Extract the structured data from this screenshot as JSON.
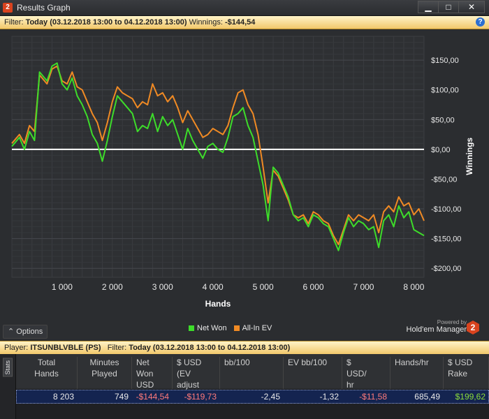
{
  "window": {
    "title": "Results Graph",
    "app_icon": "2",
    "min": "▁",
    "max": "□",
    "close": "✕"
  },
  "filter": {
    "label": "Filter:",
    "value": "Today (03.12.2018 13:00 to 04.12.2018 13:00)",
    "winnings_label": "Winnings:",
    "winnings_value": "-$144,54"
  },
  "options_label": "Options",
  "legend": {
    "net_won": "Net Won",
    "allin_ev": "All-In EV"
  },
  "powered": {
    "small": "Powered by",
    "big": "Hold'em Manager",
    "logo": "2"
  },
  "player": {
    "label": "Player:",
    "value": "ITSUNBLVBLE (PS)",
    "filter_label": "Filter:",
    "filter_value": "Today (03.12.2018 13:00 to 04.12.2018 13:00)"
  },
  "stats_tab": "Stats",
  "table": {
    "headers": [
      "Total\nHands",
      "Minutes\nPlayed",
      "Net\nWon\nUSD",
      "$ USD\n(EV\nadjust",
      "bb/100",
      "EV bb/100",
      "$\nUSD/\nhr",
      "Hands/hr",
      "$ USD\nRake"
    ],
    "row": [
      "8 203",
      "749",
      "-$144,54",
      "-$119,73",
      "-2,45",
      "-1,32",
      "-$11,58",
      "685,49",
      "$199,62"
    ]
  },
  "colors": {
    "net_won": "#3ddc2a",
    "allin_ev": "#f08a24",
    "negative": "#ff7a7a",
    "positive": "#8bdc3a"
  },
  "chart_data": {
    "type": "line",
    "xlabel": "Hands",
    "ylabel": "Winnings",
    "x_ticks": [
      "1 000",
      "2 000",
      "3 000",
      "4 000",
      "5 000",
      "6 000",
      "7 000",
      "8 000"
    ],
    "x_tick_values": [
      1000,
      2000,
      3000,
      4000,
      5000,
      6000,
      7000,
      8000
    ],
    "y_ticks": [
      "$150,00",
      "$100,00",
      "$50,00",
      "$0,00",
      "-$50,00",
      "-$100,00",
      "-$150,00",
      "-$200,00"
    ],
    "y_tick_values": [
      150,
      100,
      50,
      0,
      -50,
      -100,
      -150,
      -200
    ],
    "xlim": [
      0,
      8203
    ],
    "ylim": [
      -215,
      190
    ],
    "grid": true,
    "legend_position": "bottom",
    "series": [
      {
        "name": "Net Won",
        "x": [
          0,
          150,
          250,
          350,
          450,
          550,
          700,
          800,
          900,
          1000,
          1100,
          1200,
          1300,
          1400,
          1500,
          1600,
          1700,
          1800,
          1900,
          2000,
          2100,
          2200,
          2300,
          2400,
          2500,
          2600,
          2700,
          2800,
          2900,
          3000,
          3100,
          3200,
          3300,
          3400,
          3500,
          3600,
          3700,
          3800,
          3900,
          4000,
          4100,
          4200,
          4300,
          4400,
          4500,
          4600,
          4700,
          4800,
          4900,
          5000,
          5100,
          5200,
          5300,
          5400,
          5500,
          5600,
          5700,
          5800,
          5900,
          6000,
          6100,
          6200,
          6300,
          6400,
          6500,
          6600,
          6700,
          6800,
          6900,
          7000,
          7100,
          7200,
          7300,
          7400,
          7500,
          7600,
          7700,
          7800,
          7900,
          8000,
          8100,
          8203
        ],
        "y": [
          5,
          20,
          0,
          30,
          15,
          130,
          115,
          140,
          145,
          110,
          100,
          120,
          90,
          75,
          55,
          25,
          10,
          -20,
          15,
          55,
          90,
          80,
          70,
          60,
          30,
          40,
          35,
          60,
          30,
          55,
          40,
          50,
          25,
          0,
          35,
          15,
          0,
          -15,
          5,
          10,
          0,
          -5,
          20,
          55,
          60,
          70,
          40,
          20,
          -20,
          -60,
          -120,
          -30,
          -40,
          -60,
          -80,
          -110,
          -120,
          -115,
          -130,
          -110,
          -115,
          -125,
          -130,
          -150,
          -170,
          -140,
          -115,
          -130,
          -120,
          -125,
          -135,
          -130,
          -165,
          -120,
          -110,
          -130,
          -95,
          -115,
          -105,
          -135,
          -140,
          -145
        ]
      },
      {
        "name": "All-In EV",
        "x": [
          0,
          150,
          250,
          350,
          450,
          550,
          700,
          800,
          900,
          1000,
          1100,
          1200,
          1300,
          1400,
          1500,
          1600,
          1700,
          1800,
          1900,
          2000,
          2100,
          2200,
          2300,
          2400,
          2500,
          2600,
          2700,
          2800,
          2900,
          3000,
          3100,
          3200,
          3300,
          3400,
          3500,
          3600,
          3700,
          3800,
          3900,
          4000,
          4100,
          4200,
          4300,
          4400,
          4500,
          4600,
          4700,
          4800,
          4900,
          5000,
          5100,
          5200,
          5300,
          5400,
          5500,
          5600,
          5700,
          5800,
          5900,
          6000,
          6100,
          6200,
          6300,
          6400,
          6500,
          6600,
          6700,
          6800,
          6900,
          7000,
          7100,
          7200,
          7300,
          7400,
          7500,
          7600,
          7700,
          7800,
          7900,
          8000,
          8100,
          8203
        ],
        "y": [
          10,
          25,
          10,
          40,
          30,
          125,
          110,
          135,
          140,
          115,
          110,
          130,
          105,
          100,
          80,
          60,
          45,
          15,
          45,
          80,
          105,
          95,
          90,
          85,
          70,
          80,
          75,
          110,
          90,
          95,
          80,
          90,
          70,
          45,
          65,
          50,
          35,
          20,
          25,
          35,
          30,
          25,
          40,
          70,
          95,
          100,
          75,
          60,
          25,
          -30,
          -90,
          -35,
          -45,
          -65,
          -85,
          -110,
          -115,
          -110,
          -125,
          -105,
          -110,
          -120,
          -125,
          -145,
          -160,
          -135,
          -110,
          -120,
          -110,
          -115,
          -120,
          -110,
          -140,
          -105,
          -95,
          -105,
          -80,
          -95,
          -90,
          -110,
          -100,
          -120
        ]
      }
    ]
  }
}
